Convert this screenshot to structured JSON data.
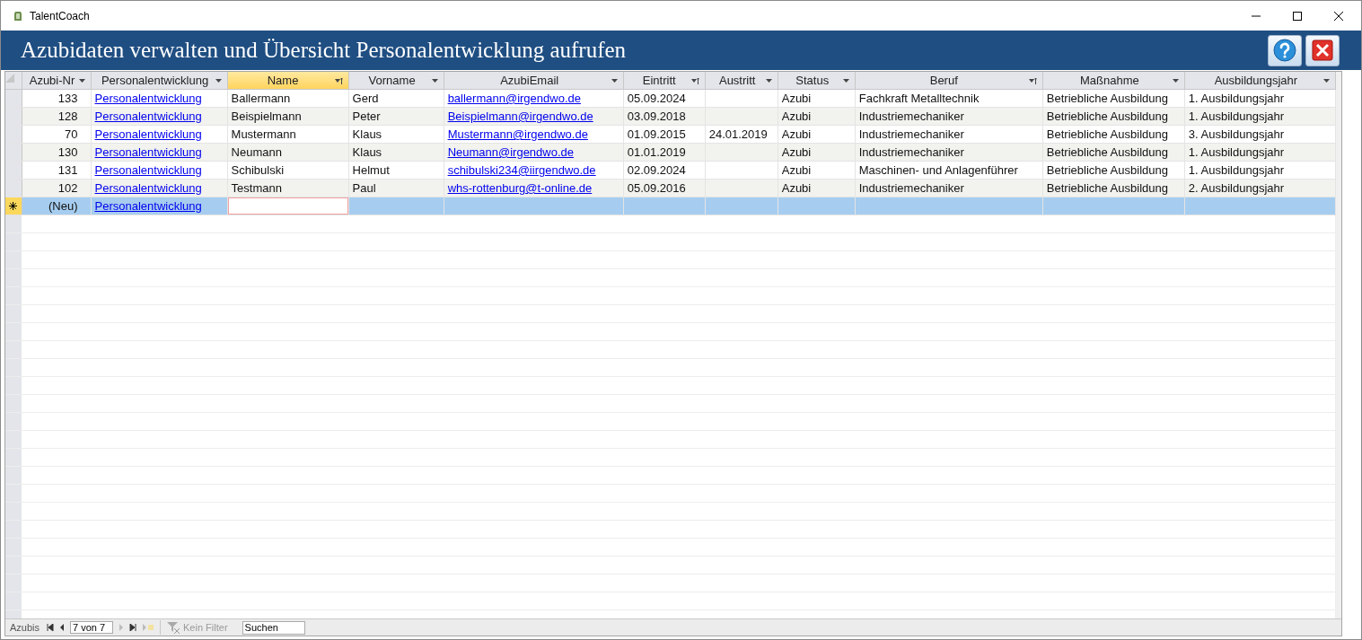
{
  "window": {
    "title": "TalentCoach"
  },
  "header": {
    "title": "Azubidaten verwalten und Übersicht Personalentwicklung aufrufen"
  },
  "table": {
    "columns": [
      {
        "label": "Azubi-Nr",
        "kind": "dropdown",
        "selected": false
      },
      {
        "label": "Personalentwicklung",
        "kind": "dropdown",
        "selected": false
      },
      {
        "label": "Name",
        "kind": "sorted",
        "selected": true
      },
      {
        "label": "Vorname",
        "kind": "dropdown",
        "selected": false
      },
      {
        "label": "AzubiEmail",
        "kind": "dropdown",
        "selected": false
      },
      {
        "label": "Eintritt",
        "kind": "sorted",
        "selected": false
      },
      {
        "label": "Austritt",
        "kind": "dropdown",
        "selected": false
      },
      {
        "label": "Status",
        "kind": "dropdown",
        "selected": false
      },
      {
        "label": "Beruf",
        "kind": "sorted",
        "selected": false
      },
      {
        "label": "Maßnahme",
        "kind": "dropdown",
        "selected": false
      },
      {
        "label": "Ausbildungsjahr",
        "kind": "dropdown",
        "selected": false
      }
    ],
    "rows": [
      {
        "new": false,
        "selected": false,
        "cells": [
          "133",
          "Personalentwicklung",
          "Ballermann",
          "Gerd",
          "ballermann@irgendwo.de",
          "05.09.2024",
          "",
          "Azubi",
          "Fachkraft Metalltechnik",
          "Betriebliche Ausbildung",
          "1. Ausbildungsjahr"
        ]
      },
      {
        "new": false,
        "selected": false,
        "cells": [
          "128",
          "Personalentwicklung",
          "Beispielmann",
          "Peter",
          "Beispielmann@irgendwo.de",
          "03.09.2018",
          "",
          "Azubi",
          "Industriemechaniker",
          "Betriebliche Ausbildung",
          "1. Ausbildungsjahr"
        ]
      },
      {
        "new": false,
        "selected": false,
        "cells": [
          "70",
          "Personalentwicklung",
          "Mustermann",
          "Klaus",
          "Mustermann@irgendwo.de",
          "01.09.2015",
          "24.01.2019",
          "Azubi",
          "Industriemechaniker",
          "Betriebliche Ausbildung",
          "3. Ausbildungsjahr"
        ]
      },
      {
        "new": false,
        "selected": false,
        "cells": [
          "130",
          "Personalentwicklung",
          "Neumann",
          "Klaus",
          "Neumann@irgendwo.de",
          "01.01.2019",
          "",
          "Azubi",
          "Industriemechaniker",
          "Betriebliche Ausbildung",
          "1. Ausbildungsjahr"
        ]
      },
      {
        "new": false,
        "selected": false,
        "cells": [
          "131",
          "Personalentwicklung",
          "Schibulski",
          "Helmut",
          "schibulski234@iirgendwo.de",
          "02.09.2024",
          "",
          "Azubi",
          "Maschinen- und Anlagenführer",
          "Betriebliche Ausbildung",
          "1. Ausbildungsjahr"
        ]
      },
      {
        "new": false,
        "selected": false,
        "cells": [
          "102",
          "Personalentwicklung",
          "Testmann",
          "Paul",
          "whs-rottenburg@t-online.de",
          "05.09.2016",
          "",
          "Azubi",
          "Industriemechaniker",
          "Betriebliche Ausbildung",
          "2. Ausbildungsjahr"
        ]
      },
      {
        "new": true,
        "selected": true,
        "cells": [
          "(Neu)",
          "Personalentwicklung",
          "",
          "",
          "",
          "",
          "",
          "",
          "",
          "",
          ""
        ]
      }
    ]
  },
  "navigation": {
    "label": "Azubis",
    "record": "7 von 7",
    "filter": "Kein Filter",
    "search": {
      "placeholder": "Suchen"
    }
  }
}
